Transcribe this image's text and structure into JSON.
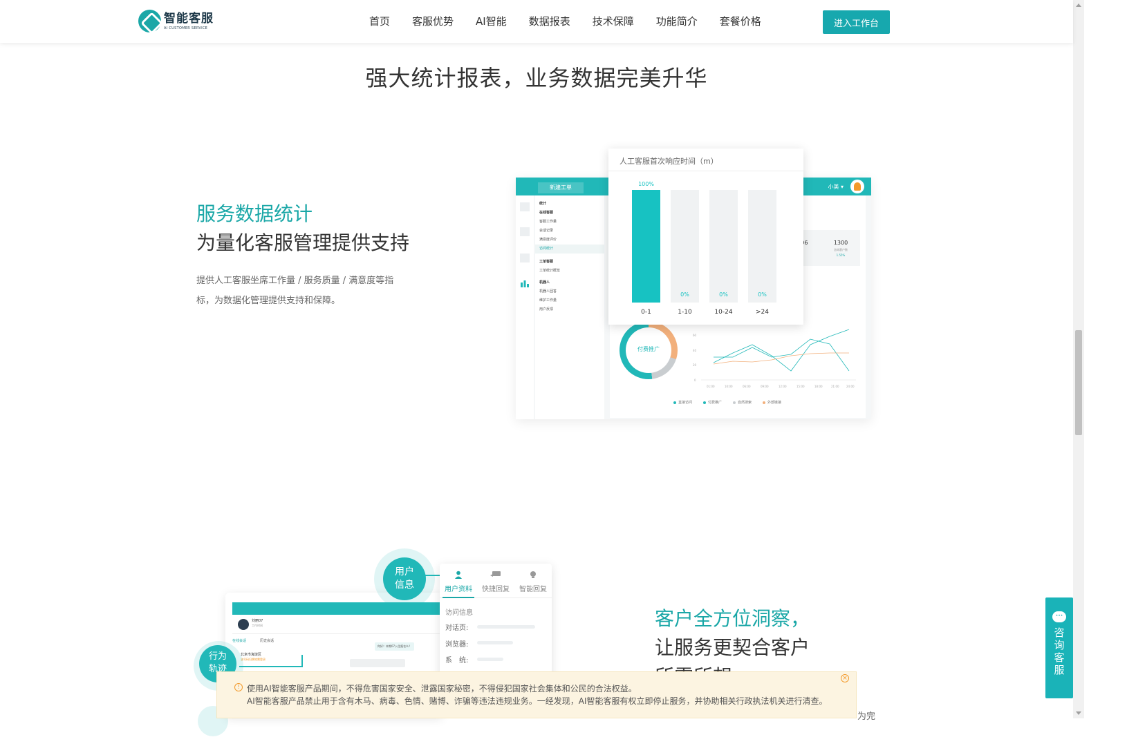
{
  "header": {
    "logo_title": "智能客服",
    "logo_sub": "AI CUSTOMER SERVICE",
    "nav": [
      "首页",
      "客服优势",
      "AI智能",
      "数据报表",
      "技术保障",
      "功能简介",
      "套餐价格"
    ],
    "enter_button": "进入工作台"
  },
  "section": {
    "title": "强大统计报表，业务数据完美升华"
  },
  "feature1": {
    "title": "服务数据统计",
    "subtitle": "为量化客服管理提供支持",
    "description": "提供人工客服坐席工作量 / 服务质量 / 满意度等指标，为数据化管理提供支持和保障。"
  },
  "mock1": {
    "new_ticket": "新建工单",
    "user": "小美 ▾",
    "side": [
      "统计",
      "在线客服",
      "客服工作量",
      "会话记录",
      "满意度评价",
      "访问统计",
      "工单客服",
      "工单统计概览",
      "机器人",
      "机器人回答",
      "维护工作量",
      "用户反馈"
    ],
    "cards": [
      {
        "value": ":06",
        "label": "",
        "change": ""
      },
      {
        "value": "1300",
        "label": "咨询客户数",
        "change": "1.55%"
      }
    ],
    "donut_label": "付费推广",
    "legend": [
      "直接访问",
      "付费推广",
      "自然搜索",
      "外部链接"
    ],
    "y_ticks": [
      "60",
      "40",
      "20",
      "0"
    ],
    "x_ticks": [
      "01:00",
      "10:00",
      "06:00",
      "09:00",
      "12:00",
      "15:00",
      "18:00",
      "21:00",
      "24:00"
    ]
  },
  "chart_data": {
    "type": "bar",
    "title": "人工客服首次响应时间（m）",
    "categories": [
      "0-1",
      "1-10",
      "10-24",
      ">24"
    ],
    "values": [
      100,
      0,
      0,
      0
    ],
    "value_labels": [
      "100%",
      "0%",
      "0%",
      "0%"
    ],
    "ylim": [
      0,
      100
    ]
  },
  "mock2": {
    "user_name": "刘丽07",
    "user_sub": "工作时间",
    "tabs": [
      "在线会话",
      "历史会话"
    ],
    "location": "北京市海淀区",
    "location_sub": "该号码归属地需登录",
    "bubble1": "你好！本期07入住报名么？",
    "circle_user": [
      "用户",
      "信息"
    ],
    "circle_track": [
      "行为",
      "轨迹"
    ]
  },
  "user_panel": {
    "tabs": [
      "用户资料",
      "快捷回复",
      "智能回复"
    ],
    "section": "访问信息",
    "rows": [
      "对话页:",
      "浏览器:",
      "系　统:"
    ]
  },
  "feature2": {
    "title": "客户全方位洞察，",
    "subtitle": "让服务更契合客户",
    "subtitle2": "所需所想",
    "cut": "为完"
  },
  "notice": {
    "line1": "使用AI智能客服产品期间，不得危害国家安全、泄露国家秘密，不得侵犯国家社会集体和公民的合法权益。",
    "line2": "AI智能客服产品禁止用于含有木马、病毒、色情、赌博、诈骗等违法违规业务。一经发现，AI智能客服有权立即停止服务，并协助相关行政执法机关进行清查。"
  },
  "consult": {
    "label": "咨询客服"
  },
  "colors": {
    "accent": "#1aa7a7",
    "bar": "#17c2c2",
    "notice_bg": "#fcf4e1"
  }
}
